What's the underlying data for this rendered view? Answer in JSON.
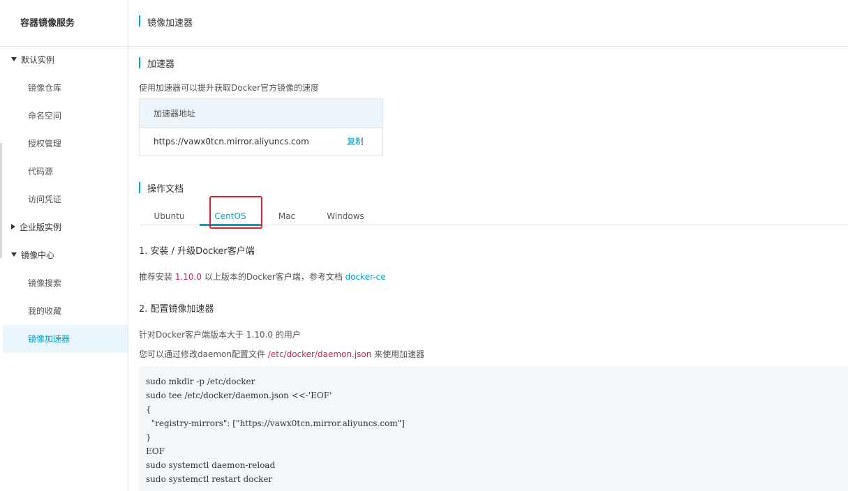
{
  "sidebar": {
    "title": "容器镜像服务",
    "groups": [
      {
        "label": "默认实例",
        "items": [
          "镜像仓库",
          "命名空间",
          "授权管理",
          "代码源",
          "访问凭证"
        ]
      },
      {
        "label": "企业版实例"
      },
      {
        "label": "镜像中心",
        "items": [
          "镜像搜索",
          "我的收藏",
          "镜像加速器"
        ]
      }
    ],
    "active": "镜像加速器"
  },
  "header": {
    "title": "镜像加速器"
  },
  "accelerator": {
    "title": "加速器",
    "desc": "使用加速器可以提升获取Docker官方镜像的速度",
    "table_header": "加速器地址",
    "url": "https://vawx0tcn.mirror.aliyuncs.com",
    "copy_label": "复制"
  },
  "docs": {
    "title": "操作文档",
    "tabs": [
      "Ubuntu",
      "CentOS",
      "Mac",
      "Windows"
    ],
    "active_tab": "CentOS"
  },
  "step1": {
    "title": "1. 安装 / 升级Docker客户端",
    "text_pre": "推荐安装 ",
    "version": "1.10.0",
    "text_mid": " 以上版本的Docker客户端，参考文档 ",
    "link": "docker-ce"
  },
  "step2": {
    "title": "2. 配置镜像加速器",
    "line1": "针对Docker客户端版本大于 1.10.0 的用户",
    "line2_pre": "您可以通过修改daemon配置文件 ",
    "line2_path": "/etc/docker/daemon.json",
    "line2_post": " 来使用加速器",
    "code": "sudo mkdir -p /etc/docker\nsudo tee /etc/docker/daemon.json <<-'EOF'\n{\n  \"registry-mirrors\": [\"https://vawx0tcn.mirror.aliyuncs.com\"]\n}\nEOF\nsudo systemctl daemon-reload\nsudo systemctl restart docker"
  },
  "colors": {
    "accent": "#00a2ca",
    "highlight": "#e0202a",
    "code_bg": "#f3f7fa"
  }
}
